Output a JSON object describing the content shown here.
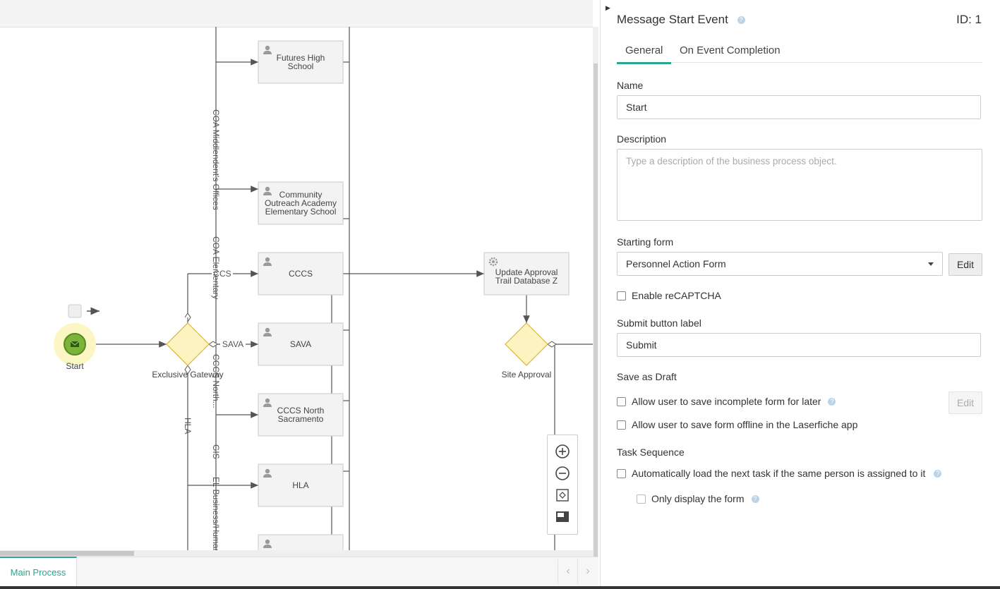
{
  "canvas": {
    "start_event_label": "Start",
    "gateway_label": "Exclusive Gateway",
    "gateway2_label": "Site Approval",
    "tasks": [
      {
        "label_lines": [
          "Futures High",
          "School"
        ]
      },
      {
        "label_lines": [
          "Community",
          "Outreach Academy",
          "Elementary School"
        ]
      },
      {
        "label_lines": [
          "CCCS"
        ]
      },
      {
        "label_lines": [
          "SAVA"
        ]
      },
      {
        "label_lines": [
          "CCCS North",
          "Sacramento"
        ]
      },
      {
        "label_lines": [
          "HLA"
        ]
      },
      {
        "label_lines": []
      }
    ],
    "service_task_lines": [
      "Update Approval",
      "Trail Database Z"
    ],
    "flow_labels": {
      "ccs": "CCS",
      "sava": "SAVA",
      "hla": "HLA",
      "vertical_1": "COA Middlendent's Offices",
      "vertical_2": "COA Elementary",
      "vertical_3": "CCCS North...",
      "vertical_4": "GIS",
      "vertical_5": "EL Business/Human"
    }
  },
  "bottom_tabs": {
    "main_process": "Main Process",
    "prev": "‹",
    "next": "›"
  },
  "panel": {
    "title": "Message Start Event",
    "id_label": "ID: 1",
    "tabs": [
      "General",
      "On Event Completion"
    ],
    "name_label": "Name",
    "name_value": "Start",
    "description_label": "Description",
    "description_placeholder": "Type a description of the business process object.",
    "starting_form_label": "Starting form",
    "starting_form_value": "Personnel Action Form",
    "edit_label": "Edit",
    "enable_recaptcha": "Enable reCAPTCHA",
    "submit_button_label_label": "Submit button label",
    "submit_button_label_value": "Submit",
    "save_as_draft": "Save as Draft",
    "allow_incomplete": "Allow user to save incomplete form for later",
    "allow_offline": "Allow user to save form offline in the Laserfiche app",
    "task_sequence": "Task Sequence",
    "auto_load_next": "Automatically load the next task if the same person is assigned to it",
    "only_display_form": "Only display the form"
  },
  "colors": {
    "accent": "#2aa58e",
    "gateway_fill": "#fdf3c0",
    "gateway_stroke": "#d8b73a",
    "start_fill": "#7bb33b"
  }
}
